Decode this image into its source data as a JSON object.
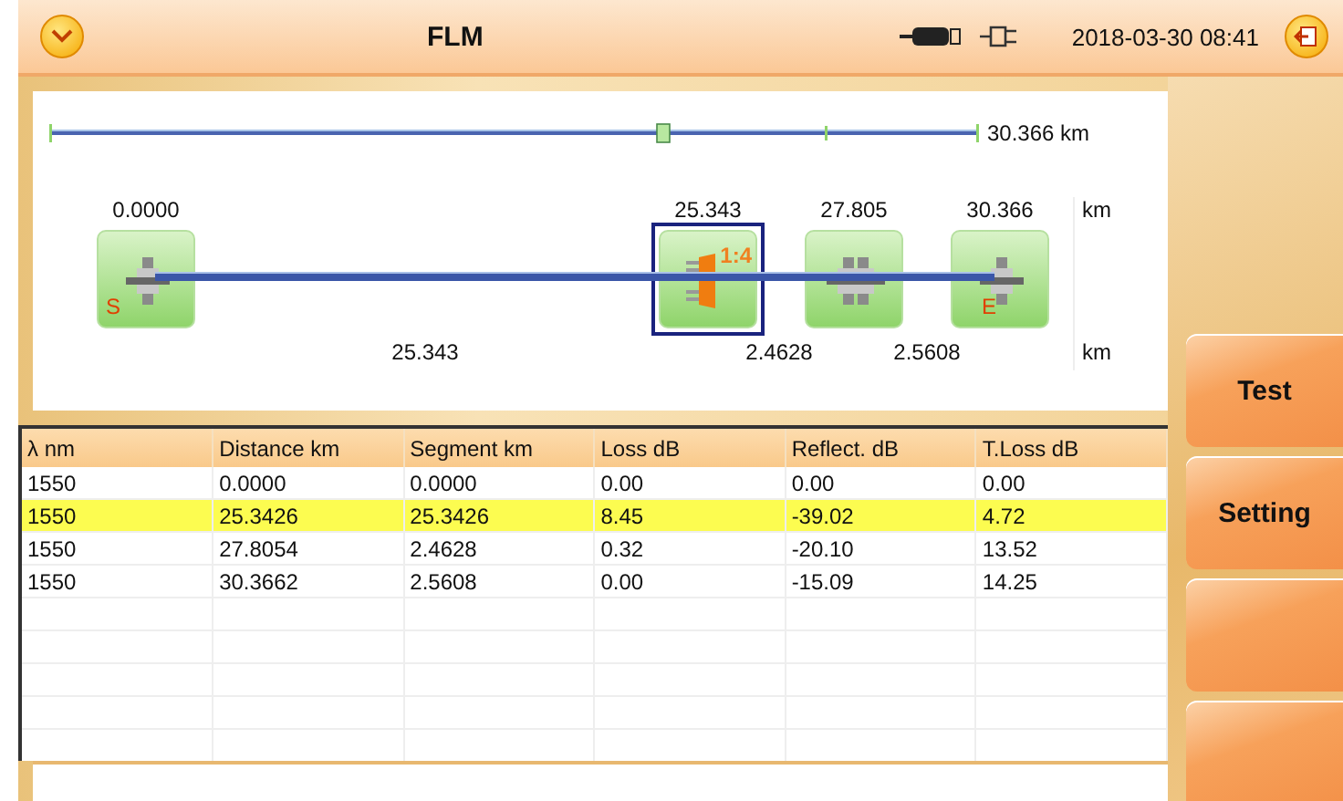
{
  "header": {
    "title": "FLM",
    "datetime": "2018-03-30 08:41"
  },
  "overview": {
    "total": "30.366 km"
  },
  "events": [
    {
      "kind": "start",
      "distance": "0.0000",
      "label": "S",
      "selected": false
    },
    {
      "kind": "splitter",
      "distance": "25.343",
      "ratio": "1:4",
      "selected": true
    },
    {
      "kind": "connector",
      "distance": "27.805",
      "selected": false
    },
    {
      "kind": "end",
      "distance": "30.366",
      "label": "E",
      "selected": false
    }
  ],
  "event_unit": "km",
  "segments": [
    "25.343",
    "2.4628",
    "2.5608"
  ],
  "segment_unit": "km",
  "table": {
    "columns": [
      "λ nm",
      "Distance km",
      "Segment km",
      "Loss dB",
      "Reflect. dB",
      "T.Loss dB"
    ],
    "rows": [
      {
        "cells": [
          "1550",
          "0.0000",
          "0.0000",
          "0.00",
          "0.00",
          "0.00"
        ],
        "selected": false
      },
      {
        "cells": [
          "1550",
          "25.3426",
          "25.3426",
          "8.45",
          "-39.02",
          "4.72"
        ],
        "selected": true
      },
      {
        "cells": [
          "1550",
          "27.8054",
          "2.4628",
          "0.32",
          "-20.10",
          "13.52"
        ],
        "selected": false
      },
      {
        "cells": [
          "1550",
          "30.3662",
          "2.5608",
          "0.00",
          "-15.09",
          "14.25"
        ],
        "selected": false
      }
    ]
  },
  "side_buttons": [
    {
      "kind": "label",
      "label": "Test"
    },
    {
      "kind": "label",
      "label": "Setting"
    },
    {
      "kind": "blank"
    },
    {
      "kind": "blank"
    }
  ]
}
